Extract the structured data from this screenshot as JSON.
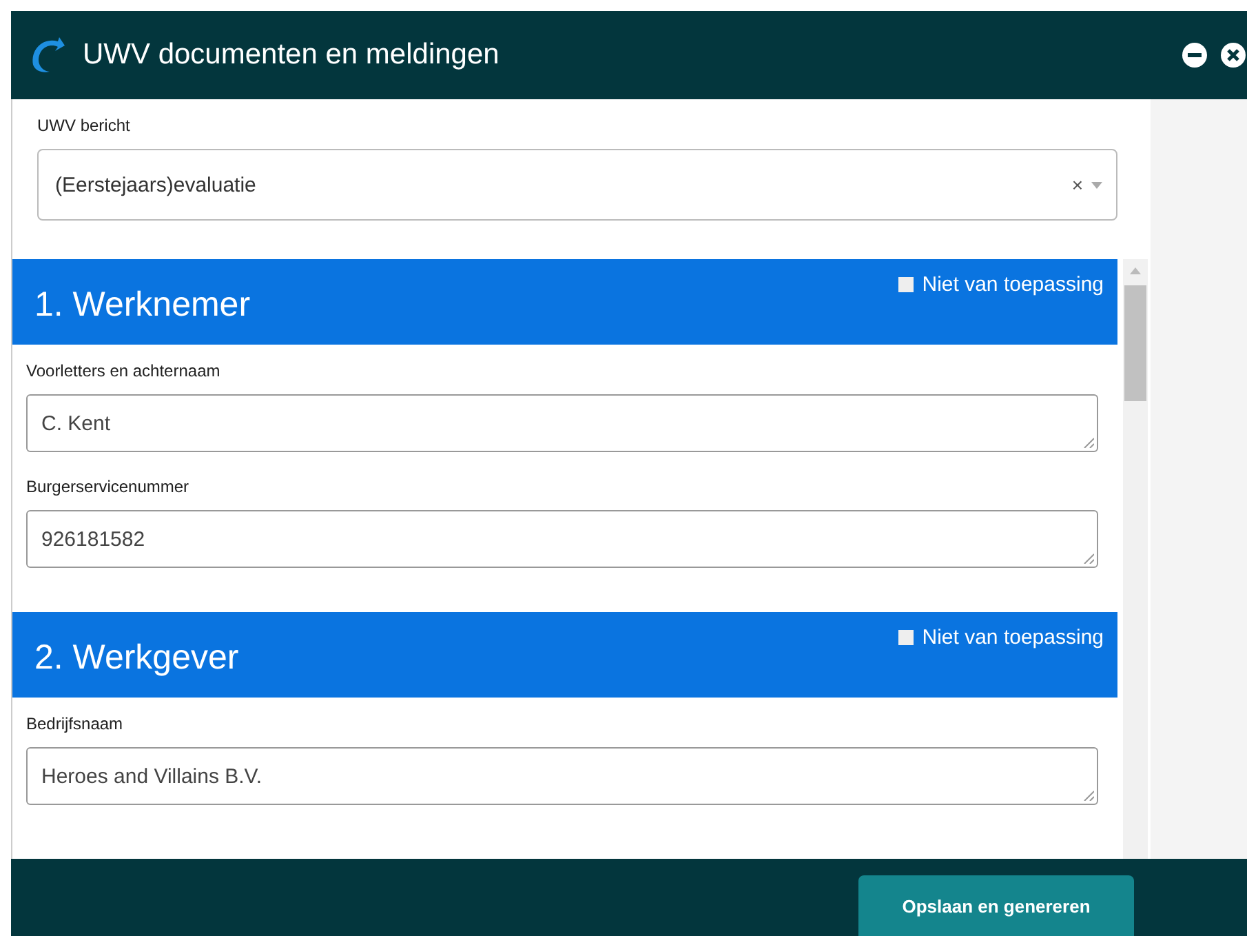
{
  "window": {
    "title": "UWV documenten en meldingen"
  },
  "message": {
    "label": "UWV bericht",
    "value": "(Eerstejaars)evaluatie",
    "clear": "×"
  },
  "sections": [
    {
      "title": "1. Werknemer",
      "not_applicable": {
        "label": "Niet van toepassing",
        "checked": false
      },
      "fields": [
        {
          "label": "Voorletters en achternaam",
          "value": "C. Kent"
        },
        {
          "label": "Burgerservicenummer",
          "value": "926181582"
        }
      ]
    },
    {
      "title": "2. Werkgever",
      "not_applicable": {
        "label": "Niet van toepassing",
        "checked": false
      },
      "fields": [
        {
          "label": "Bedrijfsnaam",
          "value": "Heroes and Villains B.V."
        }
      ]
    }
  ],
  "footer": {
    "button": "Opslaan en genereren"
  }
}
